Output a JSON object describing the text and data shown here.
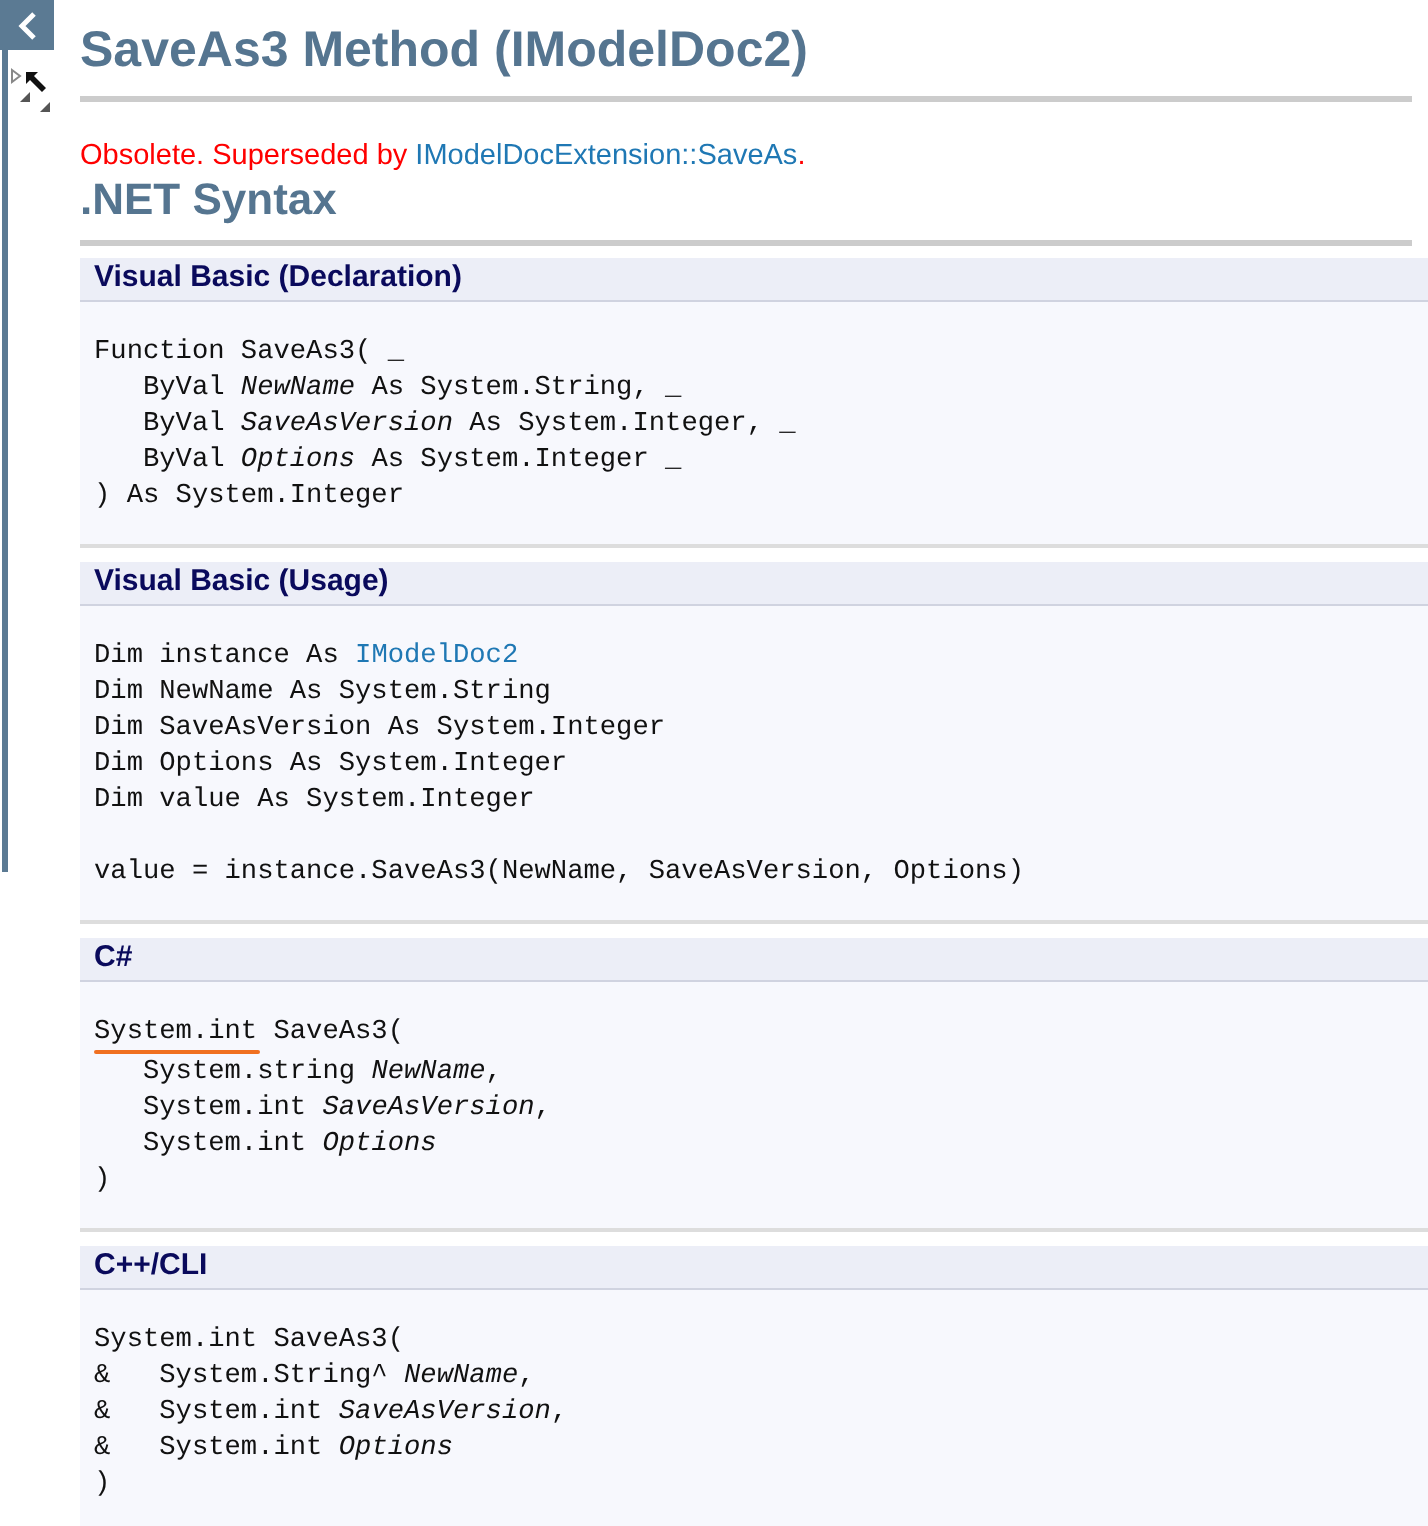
{
  "title": "SaveAs3 Method (IModelDoc2)",
  "notice": {
    "text": "Obsolete. Superseded by ",
    "link": "IModelDocExtension::SaveAs",
    "suffix": "."
  },
  "heading": ".NET Syntax",
  "sections": [
    {
      "title": "Visual Basic (Declaration)",
      "lines": [
        {
          "kind": "code",
          "text": "Function SaveAs3( _"
        },
        {
          "kind": "code",
          "text": "   ByVal *NewName* As System.String, _"
        },
        {
          "kind": "code",
          "text": "   ByVal *SaveAsVersion* As System.Integer, _"
        },
        {
          "kind": "code",
          "text": "   ByVal *Options* As System.Integer _"
        },
        {
          "kind": "code",
          "text": ") As System.Integer"
        }
      ]
    },
    {
      "title": "Visual Basic (Usage)",
      "lines": [
        {
          "kind": "link",
          "text": "Dim instance As ",
          "link": "IModelDoc2"
        },
        {
          "kind": "code",
          "text": "Dim NewName As System.String"
        },
        {
          "kind": "code",
          "text": "Dim SaveAsVersion As System.Integer"
        },
        {
          "kind": "code",
          "text": "Dim Options As System.Integer"
        },
        {
          "kind": "code",
          "text": "Dim value As System.Integer"
        },
        {
          "kind": "blank"
        },
        {
          "kind": "code",
          "text": "value = instance.SaveAs3(NewName, SaveAsVersion, Options)"
        }
      ]
    },
    {
      "title": "C#",
      "lines": [
        {
          "kind": "marked",
          "text": "System.int SaveAs3("
        },
        {
          "kind": "code",
          "text": "   System.string *NewName*,"
        },
        {
          "kind": "code",
          "text": "   System.int *SaveAsVersion*,"
        },
        {
          "kind": "code",
          "text": "   System.int *Options*"
        },
        {
          "kind": "code",
          "text": ")"
        }
      ]
    },
    {
      "title": "C++/CLI",
      "lines": [
        {
          "kind": "code",
          "text": "System.int SaveAs3("
        },
        {
          "kind": "code",
          "text": "&   System.String^ *NewName*,"
        },
        {
          "kind": "code",
          "text": "&   System.int *SaveAsVersion*,"
        },
        {
          "kind": "code",
          "text": "&   System.int *Options*"
        },
        {
          "kind": "code",
          "text": ")"
        }
      ]
    }
  ]
}
